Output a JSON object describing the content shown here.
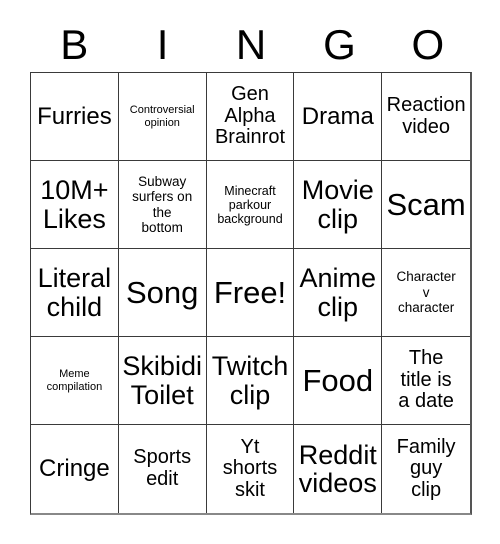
{
  "card": {
    "header_letters": [
      "B",
      "I",
      "N",
      "G",
      "O"
    ],
    "columns": 5,
    "rows": 5,
    "background_color": "#ffffff",
    "text_color": "#000000",
    "border_color": "#3a3a3a",
    "free_space_label": "Free!",
    "free_space_index": 12
  },
  "cells": [
    {
      "text": "Furries",
      "size": "fs-xl"
    },
    {
      "text": "Controversial\nopinion",
      "size": "fs-xs"
    },
    {
      "text": "Gen\nAlpha\nBrainrot",
      "size": "fs-lg"
    },
    {
      "text": "Drama",
      "size": "fs-xl"
    },
    {
      "text": "Reaction\nvideo",
      "size": "fs-lg"
    },
    {
      "text": "10M+\nLikes",
      "size": "fs-xxl"
    },
    {
      "text": "Subway\nsurfers on\nthe\nbottom",
      "size": "fs-smd"
    },
    {
      "text": "Minecraft\nparkour\nbackground",
      "size": "fs-sm"
    },
    {
      "text": "Movie\nclip",
      "size": "fs-xxl"
    },
    {
      "text": "Scam",
      "size": "fs-huge"
    },
    {
      "text": "Literal\nchild",
      "size": "fs-xxl"
    },
    {
      "text": "Song",
      "size": "fs-huge"
    },
    {
      "text": "Free!",
      "size": "fs-huge"
    },
    {
      "text": "Anime\nclip",
      "size": "fs-xxl"
    },
    {
      "text": "Character\nv\ncharacter",
      "size": "fs-smd"
    },
    {
      "text": "Meme\ncompilation",
      "size": "fs-xs"
    },
    {
      "text": "Skibidi\nToilet",
      "size": "fs-xxl"
    },
    {
      "text": "Twitch\nclip",
      "size": "fs-xxl"
    },
    {
      "text": "Food",
      "size": "fs-huge"
    },
    {
      "text": "The\ntitle is\na date",
      "size": "fs-lg"
    },
    {
      "text": "Cringe",
      "size": "fs-xl"
    },
    {
      "text": "Sports\nedit",
      "size": "fs-lg"
    },
    {
      "text": "Yt\nshorts\nskit",
      "size": "fs-lg"
    },
    {
      "text": "Reddit\nvideos",
      "size": "fs-xxl"
    },
    {
      "text": "Family\nguy\nclip",
      "size": "fs-lg"
    }
  ]
}
